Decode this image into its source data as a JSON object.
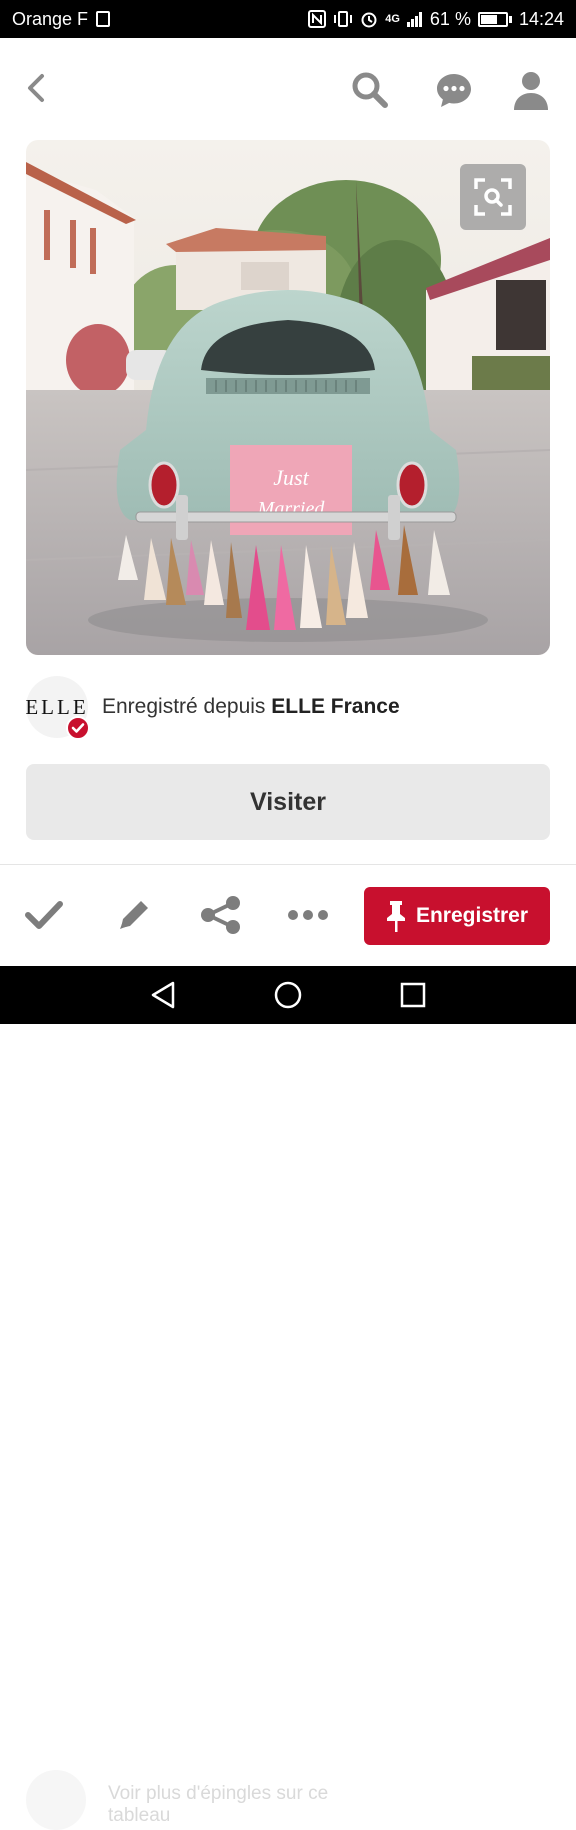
{
  "status_bar": {
    "carrier": "Orange F",
    "battery": "61 %",
    "time": "14:24",
    "signal_label": "4G"
  },
  "top_bar": {
    "back_icon": "chevron-left-icon",
    "search_icon": "search-icon",
    "chat_icon": "chat-icon",
    "profile_icon": "user-icon"
  },
  "pin": {
    "image_description_icon": "visual-search-icon",
    "sign_text": "Just Married"
  },
  "source": {
    "logo_text": "ELLE",
    "prefix": "Enregistré depuis",
    "name": "ELLE France"
  },
  "actions": {
    "visit_label": "Visiter",
    "save_label": "Enregistrer"
  },
  "bottom_bar": {
    "ghost_line1": "Voir plus d'épingles sur ce",
    "ghost_line2": "tableau"
  },
  "colors": {
    "brand_red": "#c8102e",
    "icon_gray": "#8a8a8a",
    "visit_bg": "#e9e9e9"
  }
}
